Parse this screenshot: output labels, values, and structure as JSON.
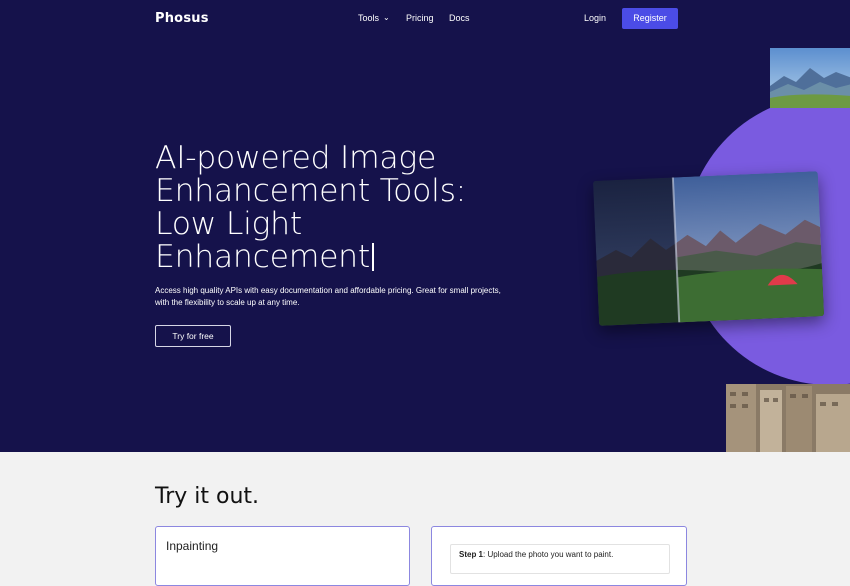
{
  "colors": {
    "hero_bg": "#15124b",
    "accent": "#4b4ce6",
    "circle": "#7a5be0",
    "section_bg": "#f2f2f2"
  },
  "nav": {
    "logo": "Phosus",
    "links": [
      {
        "label": "Tools",
        "icon": "chevron-down-icon"
      },
      {
        "label": "Pricing"
      },
      {
        "label": "Docs"
      }
    ],
    "login": "Login",
    "register": "Register"
  },
  "hero": {
    "title_lines": [
      "AI-powered Image",
      "Enhancement Tools:",
      "Low Light",
      "Enhancement"
    ],
    "subtitle": "Access high quality APIs with easy documentation and affordable pricing. Great for small projects, with the flexibility to scale up at any time.",
    "cta": "Try for free"
  },
  "tryout": {
    "heading": "Try it out.",
    "left_card_title": "Inpainting",
    "step_label": "Step 1",
    "step_text": ": Upload the photo you want to paint."
  }
}
